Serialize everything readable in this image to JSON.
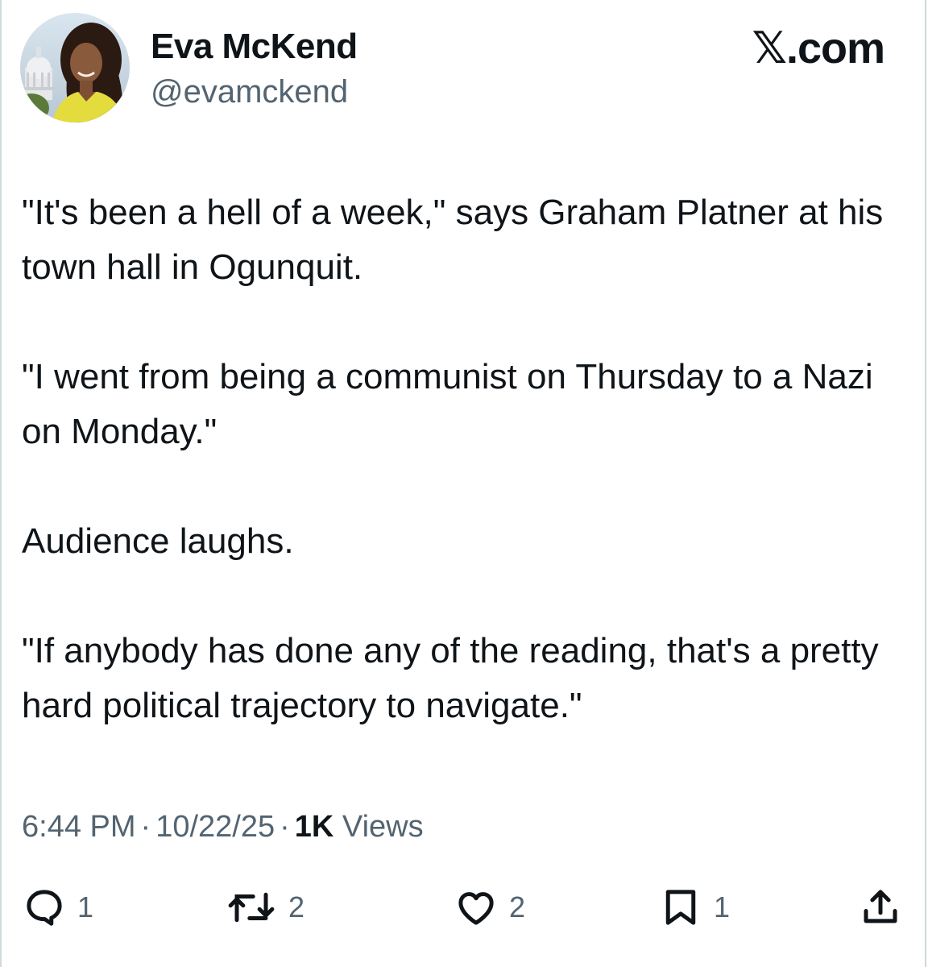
{
  "author": {
    "display_name": "Eva McKend",
    "handle": "@evamckend",
    "avatar_icon": "profile-photo"
  },
  "brand": {
    "label": "𝕏.com"
  },
  "tweet": {
    "paragraphs": [
      "\"It's been a hell of a week,\" says Graham Platner at his town hall in Ogunquit.",
      "\"I went from being a communist on Thursday to a Nazi on Monday.\"",
      "Audience laughs.",
      "\"If anybody has done any of the reading, that's a pretty hard political trajectory to navigate.\""
    ]
  },
  "meta": {
    "time": "6:44 PM",
    "separator": "·",
    "date": "10/22/25",
    "views_count": "1K",
    "views_label": "Views"
  },
  "actions": {
    "reply": {
      "icon": "reply-icon",
      "count": "1"
    },
    "retweet": {
      "icon": "retweet-icon",
      "count": "2"
    },
    "like": {
      "icon": "heart-icon",
      "count": "2"
    },
    "bookmark": {
      "icon": "bookmark-icon",
      "count": "1"
    },
    "share": {
      "icon": "share-icon"
    }
  },
  "colors": {
    "text_primary": "#0f1419",
    "text_secondary": "#536471",
    "border": "#cfd9de"
  }
}
